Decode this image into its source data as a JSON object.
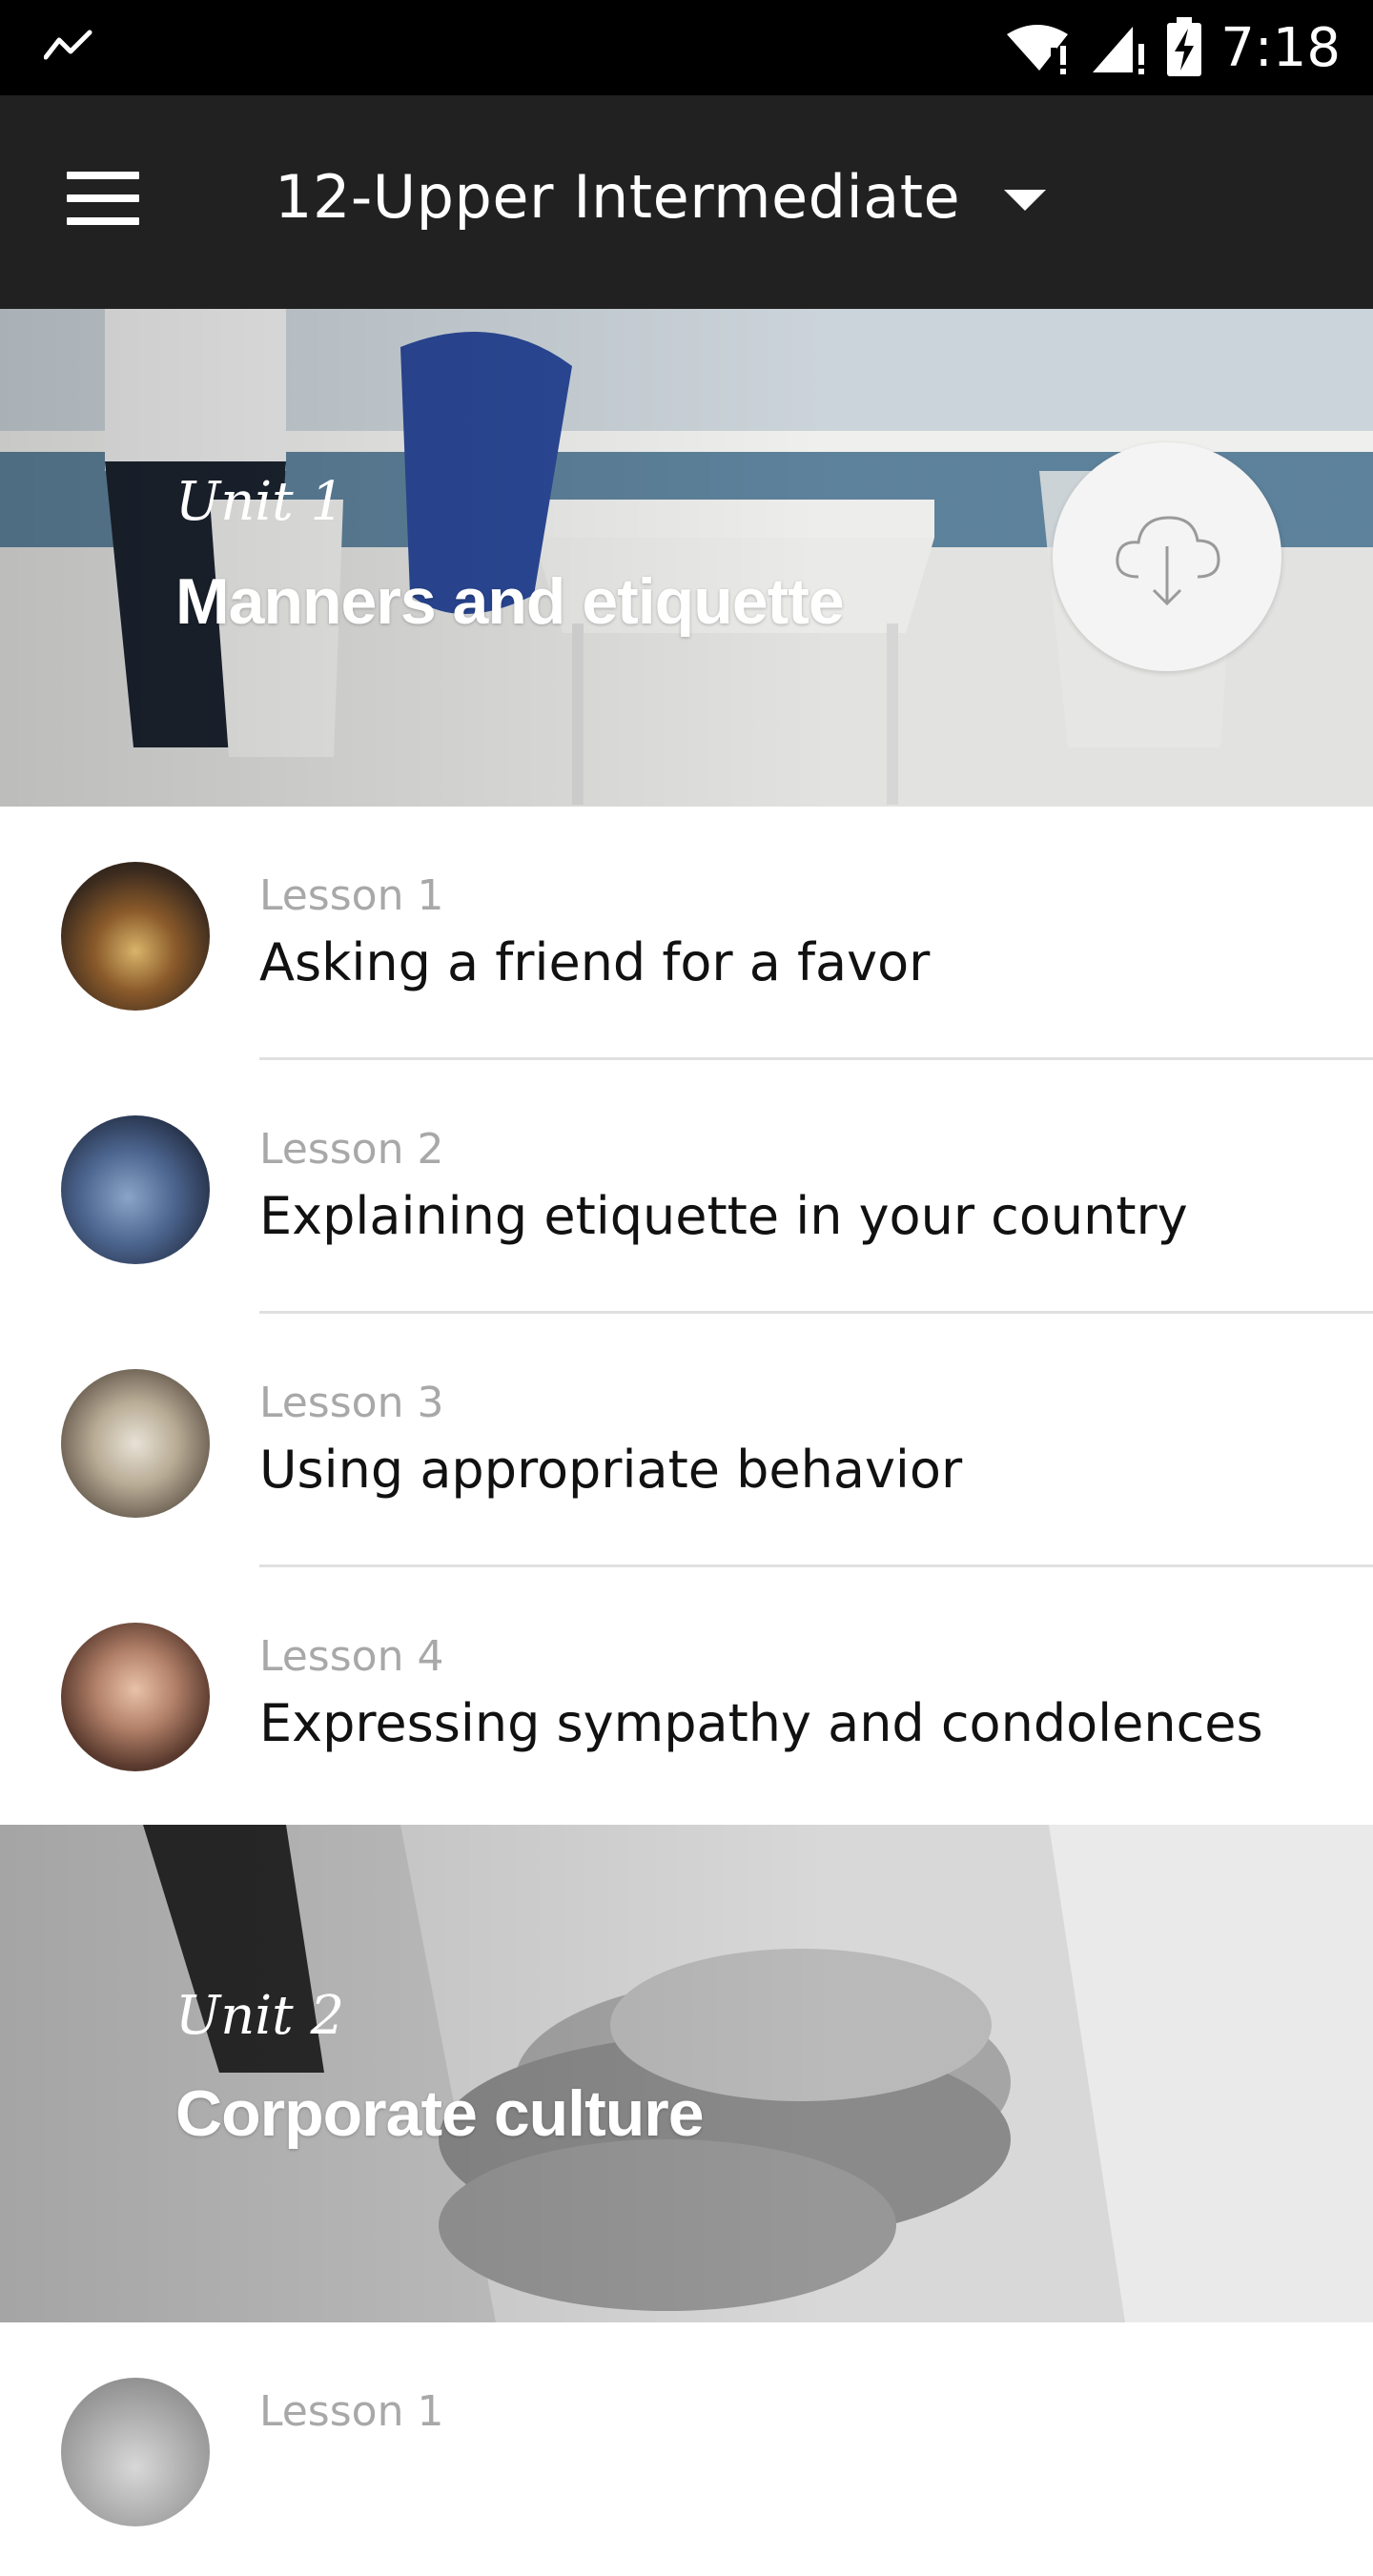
{
  "status_bar": {
    "time": "7:18",
    "icons": [
      "activity-icon",
      "wifi-alert-icon",
      "signal-alert-icon",
      "battery-charging-icon"
    ]
  },
  "app_bar": {
    "menu_icon": "hamburger-icon",
    "title": "12-Upper Intermediate",
    "dropdown_icon": "dropdown-caret-icon"
  },
  "units": [
    {
      "number": "Unit 1",
      "title": "Manners and etiquette",
      "download_icon": "cloud-download-icon",
      "lessons": [
        {
          "number": "Lesson 1",
          "title": "Asking a friend for a favor"
        },
        {
          "number": "Lesson 2",
          "title": "Explaining etiquette in your country"
        },
        {
          "number": "Lesson 3",
          "title": "Using appropriate behavior"
        },
        {
          "number": "Lesson 4",
          "title": "Expressing sympathy and condolences"
        }
      ]
    },
    {
      "number": "Unit 2",
      "title": "Corporate culture",
      "lessons": [
        {
          "number": "Lesson 1",
          "title": ""
        }
      ]
    }
  ],
  "colors": {
    "status_bar": "#000000",
    "app_bar": "#212121",
    "lesson_number": "#a8a8a8",
    "lesson_title": "#111111",
    "divider": "#e0e0e0"
  }
}
